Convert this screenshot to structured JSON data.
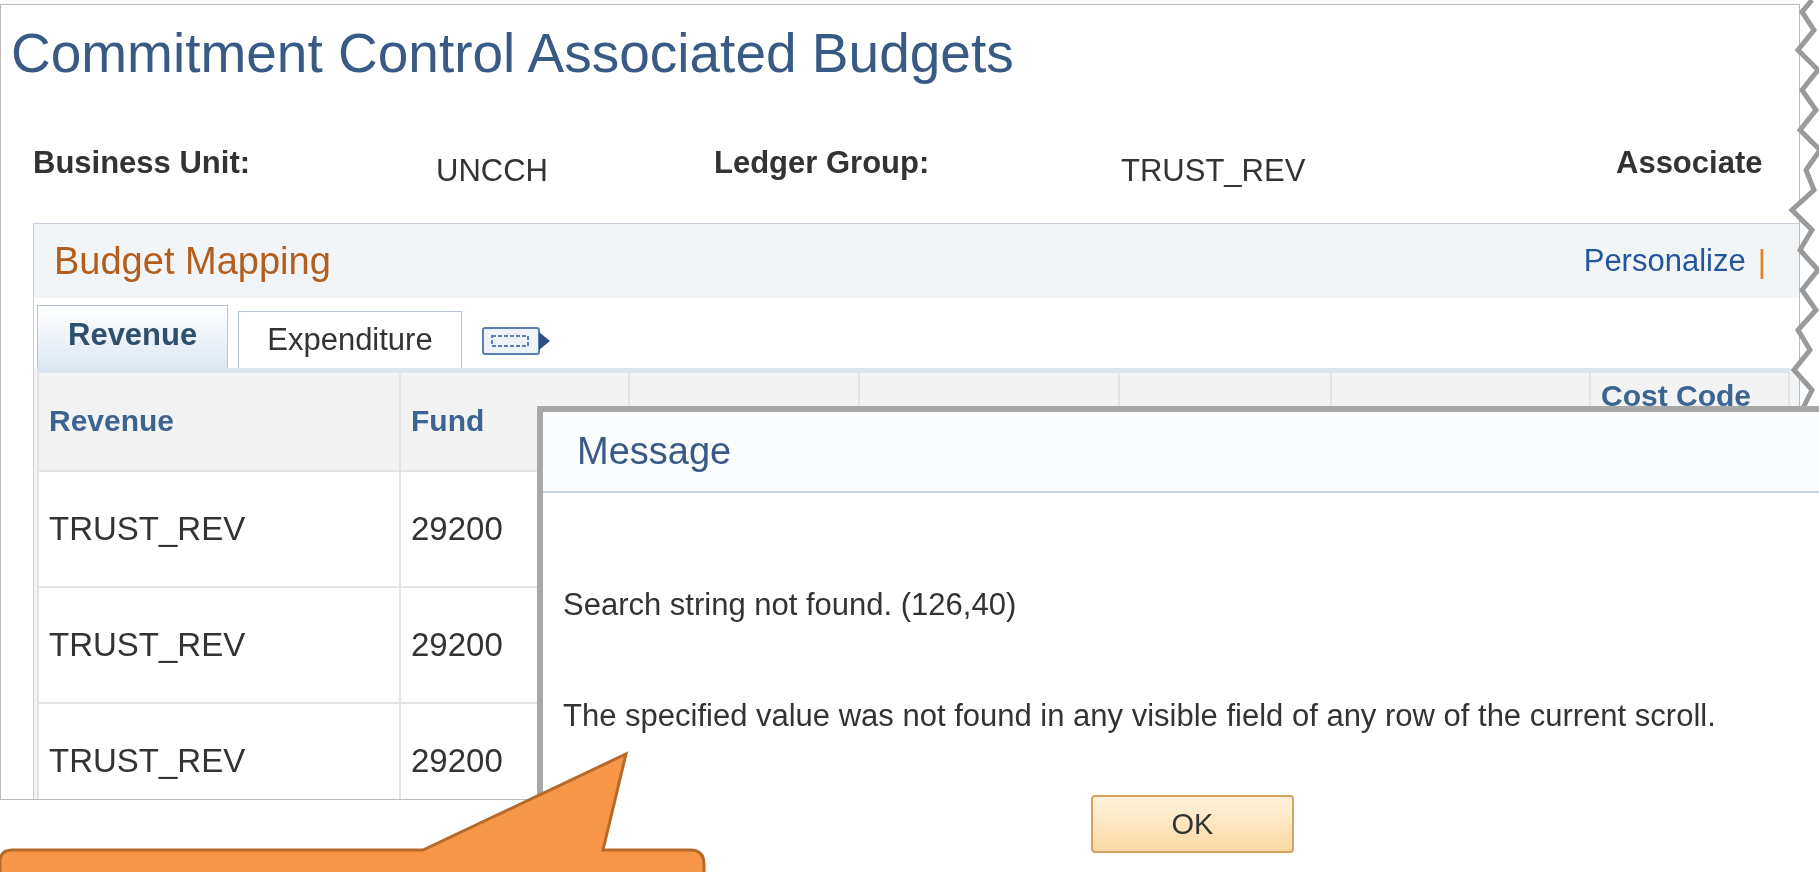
{
  "page": {
    "title": "Commitment Control Associated Budgets"
  },
  "fields": [
    {
      "label": "Business Unit:",
      "value": "UNCCH"
    },
    {
      "label": "Ledger Group:",
      "value": "TRUST_REV"
    },
    {
      "label": "Associate"
    }
  ],
  "budget_mapping": {
    "title": "Budget Mapping",
    "links": [
      "Personalize"
    ],
    "separator": "|",
    "tabs": [
      {
        "label": "Revenue",
        "selected": true
      },
      {
        "label": "Expenditure",
        "selected": false
      }
    ],
    "table": {
      "columns": [
        {
          "label": "Revenue"
        },
        {
          "label": "Fund"
        },
        {},
        {},
        {},
        {},
        {
          "label": "Cost Code"
        }
      ],
      "rows": [
        [
          "TRUST_REV",
          "29200"
        ],
        [
          "TRUST_REV",
          "29200"
        ],
        [
          "TRUST_REV",
          "29200"
        ]
      ]
    }
  },
  "dialog": {
    "title": "Message",
    "lines": [
      "Search string not found. (126,40)",
      "The specified value was not found in any visible field of any row of the current scroll."
    ],
    "button": "OK"
  }
}
